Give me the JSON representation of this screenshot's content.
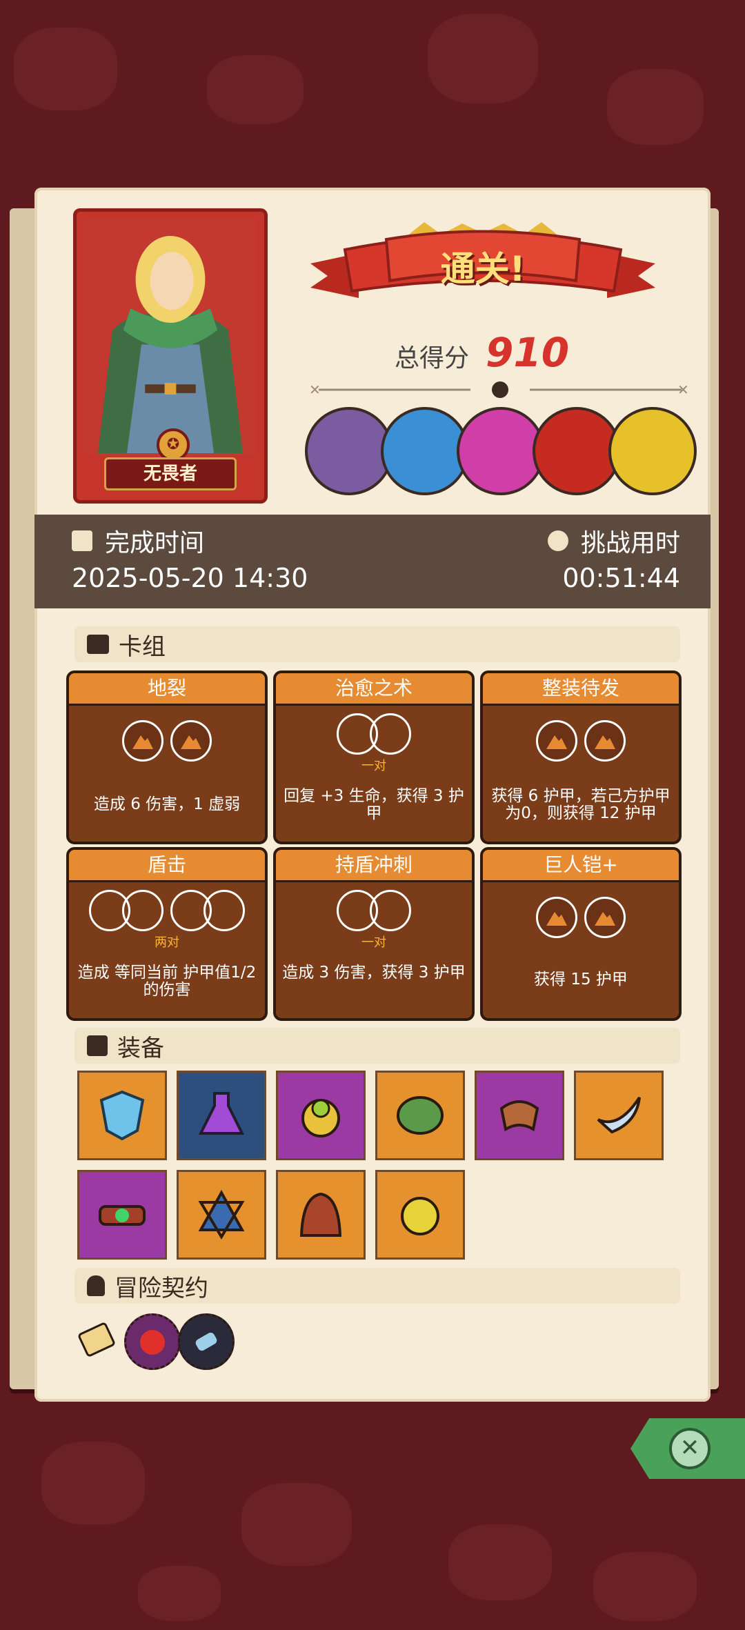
{
  "hero": {
    "name": "无畏者"
  },
  "banner": {
    "title": "通关!"
  },
  "score": {
    "label": "总得分",
    "value": "910"
  },
  "bosses": [
    {
      "icon": "stone-golem-boss-icon",
      "color": "#7b5ca0"
    },
    {
      "icon": "crowned-spirit-boss-icon",
      "color": "#3b8fd4"
    },
    {
      "icon": "shadow-demon-boss-icon",
      "color": "#d03ea8"
    },
    {
      "icon": "red-hat-lord-boss-icon",
      "color": "#c62b22"
    },
    {
      "icon": "rainbow-beast-boss-icon",
      "color": "#e6c12a"
    }
  ],
  "time": {
    "finish_label": "完成时间",
    "finish_value": "2025-05-20 14:30",
    "duration_label": "挑战用时",
    "duration_value": "00:51:44"
  },
  "deck": {
    "section_label": "卡组",
    "cards": [
      {
        "title": "地裂",
        "desc": "造成 6 伤害，1 虚弱"
      },
      {
        "title": "治愈之术",
        "pair_label": "一对",
        "desc": "回复 +3 生命，获得 3 护甲"
      },
      {
        "title": "整装待发",
        "desc": "获得 6 护甲，若己方护甲为0，则获得 12 护甲"
      },
      {
        "title": "盾击",
        "pair_label": "两对",
        "desc": "造成 等同当前 护甲值1/2 的伤害"
      },
      {
        "title": "持盾冲刺",
        "pair_label": "一对",
        "desc": "造成 3 伤害，获得 3 护甲"
      },
      {
        "title": "巨人铠+",
        "desc": "获得 15 护甲"
      }
    ]
  },
  "equipment": {
    "section_label": "装备",
    "items": [
      {
        "icon": "blue-shield-icon",
        "bg": "#e5922e"
      },
      {
        "icon": "purple-potion-icon",
        "bg": "#2d4f7d"
      },
      {
        "icon": "gold-ring-icon",
        "bg": "#9b3aa3"
      },
      {
        "icon": "turtle-shell-icon",
        "bg": "#e5922e"
      },
      {
        "icon": "leather-bracer-icon",
        "bg": "#9b3aa3"
      },
      {
        "icon": "horn-icon",
        "bg": "#e5922e"
      },
      {
        "icon": "gem-belt-icon",
        "bg": "#9b3aa3"
      },
      {
        "icon": "star-amulet-icon",
        "bg": "#e5922e"
      },
      {
        "icon": "hood-icon",
        "bg": "#e5922e"
      },
      {
        "icon": "rune-seal-icon",
        "bg": "#e5922e"
      }
    ]
  },
  "contracts": {
    "section_label": "冒险契约",
    "items": [
      {
        "icon": "scroll-icon"
      },
      {
        "icon": "red-demon-icon"
      },
      {
        "icon": "crystal-bandage-icon"
      }
    ]
  },
  "colors": {
    "background": "#5e1a1e",
    "paper": "#f7ecd7",
    "accent_red": "#d5332c",
    "card_header": "#e68b32",
    "card_body": "#7a3c19",
    "armor_blue": "#5aa6e6",
    "heal_green": "#3fd44a"
  }
}
